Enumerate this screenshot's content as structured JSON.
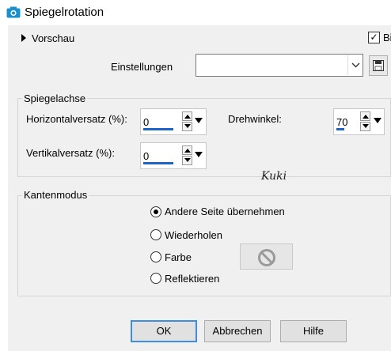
{
  "window": {
    "title": "Spiegelrotation"
  },
  "preview": {
    "label": "Vorschau",
    "checkbox_label": "Bi",
    "checked": true
  },
  "settings": {
    "label": "Einstellungen",
    "value": ""
  },
  "mirror_axis": {
    "group_label": "Spiegelachse",
    "horizontal_offset": {
      "label": "Horizontalversatz (%):",
      "value": "0",
      "fill": 0.5
    },
    "vertical_offset": {
      "label": "Vertikalversatz (%):",
      "value": "0",
      "fill": 0.5
    },
    "rotation_angle": {
      "label": "Drehwinkel:",
      "value": "70",
      "fill": 0.2
    }
  },
  "edge_mode": {
    "group_label": "Kantenmodus",
    "options": [
      {
        "label": "Andere Seite übernehmen",
        "selected": true
      },
      {
        "label": "Wiederholen",
        "selected": false
      },
      {
        "label": "Farbe",
        "selected": false
      },
      {
        "label": "Reflektieren",
        "selected": false
      }
    ],
    "color_icon": "no-color-icon"
  },
  "buttons": {
    "ok": "OK",
    "cancel": "Abbrechen",
    "help": "Hilfe"
  },
  "signature": "Kuki",
  "colors": {
    "accent": "#1e64c8",
    "default_border": "#3c8ee0",
    "title_icon": "#1a8fc9"
  }
}
